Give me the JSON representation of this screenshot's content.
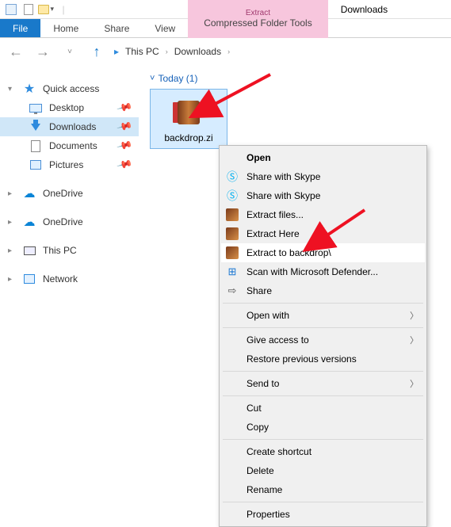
{
  "ribbon": {
    "file": "File",
    "home": "Home",
    "share": "Share",
    "view": "View",
    "ctx_title": "Extract",
    "ctx_sub": "Compressed Folder Tools",
    "title": "Downloads"
  },
  "breadcrumb": {
    "root": "This PC",
    "child": "Downloads"
  },
  "sidebar": {
    "quick": "Quick access",
    "items": [
      {
        "label": "Desktop"
      },
      {
        "label": "Downloads"
      },
      {
        "label": "Documents"
      },
      {
        "label": "Pictures"
      }
    ],
    "onedrive1": "OneDrive",
    "onedrive2": "OneDrive",
    "thispc": "This PC",
    "network": "Network"
  },
  "content": {
    "group": "Today (1)",
    "file": {
      "name": "backdrop.zi"
    }
  },
  "ctx": {
    "open": "Open",
    "skype1": "Share with Skype",
    "skype2": "Share with Skype",
    "extract_files": "Extract files...",
    "extract_here": "Extract Here",
    "extract_to": "Extract to backdrop\\",
    "defender": "Scan with Microsoft Defender...",
    "share": "Share",
    "open_with": "Open with",
    "give_access": "Give access to",
    "restore": "Restore previous versions",
    "send_to": "Send to",
    "cut": "Cut",
    "copy": "Copy",
    "shortcut": "Create shortcut",
    "delete": "Delete",
    "rename": "Rename",
    "properties": "Properties"
  }
}
